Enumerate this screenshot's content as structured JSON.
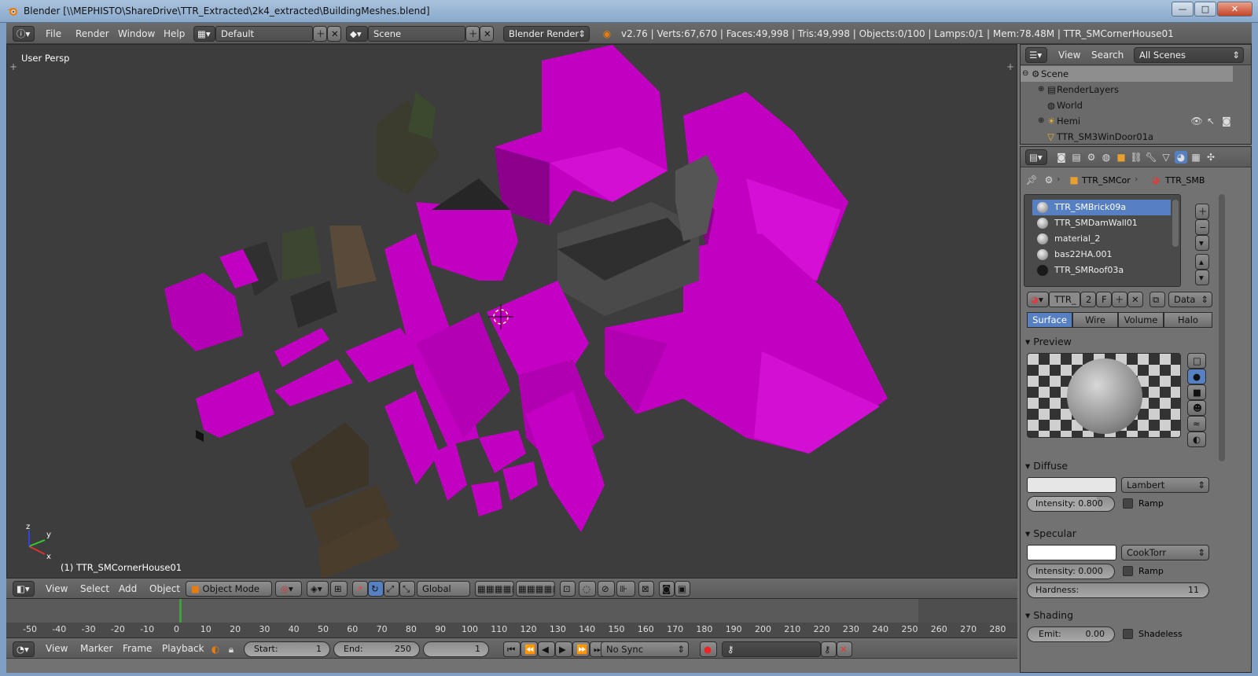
{
  "window": {
    "title": "Blender [\\\\MEPHISTO\\ShareDrive\\TTR_Extracted\\2k4_extracted\\BuildingMeshes.blend]",
    "controls": {
      "minimize": "—",
      "maximize": "□",
      "close": "✕"
    }
  },
  "info_header": {
    "menus": [
      "File",
      "Render",
      "Window",
      "Help"
    ],
    "screen_layout": "Default",
    "scene": "Scene",
    "render_engine": "Blender Render",
    "stats": "v2.76 | Verts:67,670 | Faces:49,998 | Tris:49,998 | Objects:0/100 | Lamps:0/1 | Mem:78.48M | TTR_SMCornerHouse01"
  },
  "viewport": {
    "view_label": "User Persp",
    "object_label": "(1) TTR_SMCornerHouse01",
    "axis": {
      "x": "x",
      "y": "y",
      "z": "z"
    }
  },
  "view3d_header": {
    "menus": [
      "View",
      "Select",
      "Add",
      "Object"
    ],
    "mode": "Object Mode",
    "orientation": "Global"
  },
  "timeline": {
    "ticks": [
      "-50",
      "-40",
      "-30",
      "-20",
      "-10",
      "0",
      "10",
      "20",
      "30",
      "40",
      "50",
      "60",
      "70",
      "80",
      "90",
      "100",
      "110",
      "120",
      "130",
      "140",
      "150",
      "160",
      "170",
      "180",
      "190",
      "200",
      "210",
      "220",
      "230",
      "240",
      "250",
      "260",
      "270",
      "280"
    ],
    "menus": [
      "View",
      "Marker",
      "Frame",
      "Playback"
    ],
    "start_label": "Start:",
    "start_value": "1",
    "end_label": "End:",
    "end_value": "250",
    "current_frame": "1",
    "sync": "No Sync"
  },
  "outliner": {
    "menus": [
      "View",
      "Search"
    ],
    "filter": "All Scenes",
    "items": [
      {
        "label": "Scene",
        "indent": 0
      },
      {
        "label": "RenderLayers",
        "indent": 1
      },
      {
        "label": "World",
        "indent": 1
      },
      {
        "label": "Hemi",
        "indent": 1
      },
      {
        "label": "TTR_SM3WinDoor01a",
        "indent": 1
      }
    ]
  },
  "properties": {
    "breadcrumb": {
      "object": "TTR_SMCor",
      "material": "TTR_SMB"
    },
    "material_slots": [
      {
        "name": "TTR_SMBrick09a",
        "selected": true
      },
      {
        "name": "TTR_SMDamWall01",
        "selected": false
      },
      {
        "name": "material_2",
        "selected": false
      },
      {
        "name": "bas22HA.001",
        "selected": false
      },
      {
        "name": "TTR_SMRoof03a",
        "selected": false,
        "dark": true
      }
    ],
    "datablock": {
      "name": "TTR_",
      "users": "2",
      "fake": "F",
      "link": "Data"
    },
    "tabs": [
      "Surface",
      "Wire",
      "Volume",
      "Halo"
    ],
    "active_tab": "Surface",
    "preview": {
      "title": "Preview"
    },
    "diffuse": {
      "title": "Diffuse",
      "shader": "Lambert",
      "intensity_label": "Intensity:",
      "intensity": "0.800",
      "intensity_level": 0.8,
      "ramp": "Ramp",
      "color": "#e6e6e6"
    },
    "specular": {
      "title": "Specular",
      "shader": "CookTorr",
      "intensity_label": "Intensity:",
      "intensity": "0.000",
      "intensity_level": 0,
      "ramp": "Ramp",
      "hardness_label": "Hardness:",
      "hardness": "11",
      "color": "#ffffff"
    },
    "shading": {
      "title": "Shading",
      "emit_label": "Emit:",
      "emit": "0.00",
      "shadeless": "Shadeless"
    }
  },
  "colors": {
    "magenta": "#c800c8",
    "selection": "#5680c2",
    "viewport_bg": "#3d3d3d"
  }
}
